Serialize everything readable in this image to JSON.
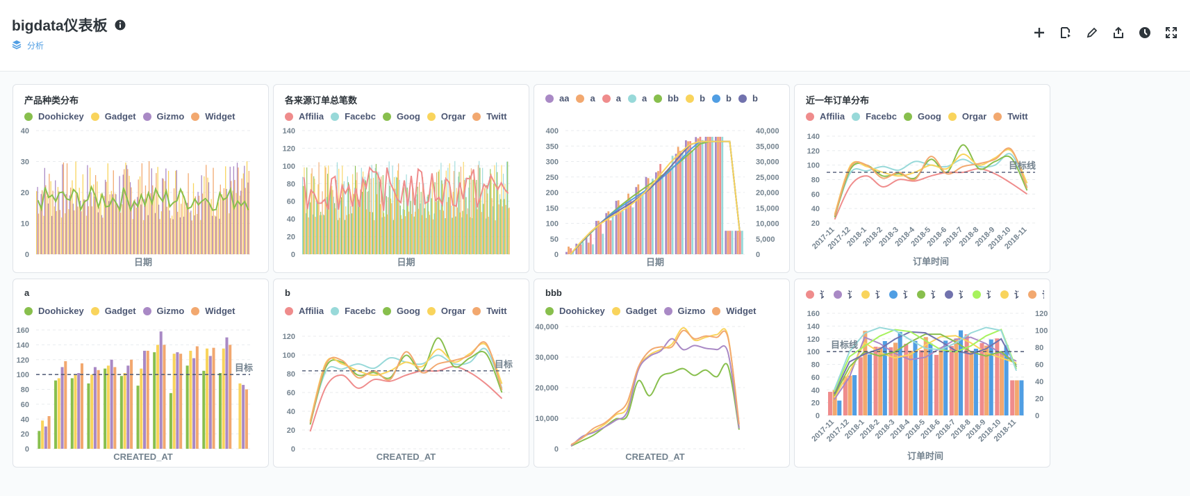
{
  "dashboard": {
    "title": "bigdata仪表板",
    "collection": "分析"
  },
  "actions": [
    "add-icon",
    "add-file-icon",
    "edit-icon",
    "share-icon",
    "history-icon",
    "fullscreen-icon"
  ],
  "colors": {
    "Doohickey": "#88bf4d",
    "Gadget": "#f9d45c",
    "Gizmo": "#a989c5",
    "Widget": "#f2a86f",
    "Affiliate": "#ef8c8c",
    "Facebook": "#98d9d9",
    "Google": "#88bf4d",
    "Organic": "#f9d45c",
    "Twitter": "#f2a86f",
    "blue": "#509ee3",
    "indigo": "#7172ad",
    "lime": "#a6e7f3"
  },
  "cards": [
    {
      "id": "c1",
      "title": "产品种类分布",
      "legend": [
        "Doohickey",
        "Gadget",
        "Gizmo",
        "Widget"
      ],
      "chart_data": {
        "type": "bar",
        "title": "产品种类分布",
        "xlabel": "日期",
        "ylim": [
          0,
          45
        ],
        "yticks": [
          "0",
          "10",
          "20",
          "30",
          "40"
        ],
        "series": [
          {
            "name": "Doohickey",
            "render": "line"
          },
          {
            "name": "Gadget"
          },
          {
            "name": "Gizmo"
          },
          {
            "name": "Widget"
          }
        ]
      }
    },
    {
      "id": "c2",
      "title": "各来源订单总笔数",
      "legend": [
        "Affiliate",
        "Facebook",
        "Google",
        "Organic",
        "Twitter"
      ],
      "legend_display": [
        "Affilia",
        "Facebc",
        "Goog",
        "Orgar",
        "Twitt"
      ],
      "chart_data": {
        "type": "bar",
        "title": "各来源订单总笔数",
        "xlabel": "日期",
        "ylim": [
          0,
          150
        ],
        "yticks": [
          "0",
          "20",
          "40",
          "60",
          "80",
          "100",
          "120",
          "140"
        ],
        "series": [
          {
            "name": "Affiliate",
            "render": "line"
          },
          {
            "name": "Facebook"
          },
          {
            "name": "Google"
          },
          {
            "name": "Organic"
          },
          {
            "name": "Twitter"
          }
        ]
      }
    },
    {
      "id": "c3",
      "title": "",
      "legend": [
        "aa",
        "a",
        "a",
        "a",
        "bb",
        "b",
        "b",
        "b"
      ],
      "legend_colors": [
        "#a989c5",
        "#f2a86f",
        "#ef8c8c",
        "#98d9d9",
        "#88bf4d",
        "#f9d45c",
        "#509ee3",
        "#7172ad"
      ],
      "chart_data": {
        "type": "bar",
        "xlabel": "日期",
        "ylim": [
          0,
          400
        ],
        "yticks": [
          "0",
          "50",
          "100",
          "150",
          "200",
          "250",
          "300",
          "350",
          "400"
        ],
        "y2ticks": [
          "0",
          "5,000",
          "10,000",
          "15,000",
          "20,000",
          "25,000",
          "30,000",
          "35,000",
          "40,000"
        ],
        "y2lim": [
          0,
          40000
        ],
        "series": [
          {
            "name": "aa"
          },
          {
            "name": "a"
          },
          {
            "name": "a"
          },
          {
            "name": "a"
          },
          {
            "name": "bb",
            "render": "line"
          },
          {
            "name": "b",
            "render": "line"
          },
          {
            "name": "b",
            "render": "line"
          },
          {
            "name": "b",
            "render": "line"
          }
        ]
      }
    },
    {
      "id": "c4",
      "title": "近一年订单分布",
      "legend": [
        "Affiliate",
        "Facebook",
        "Google",
        "Organic",
        "Twitter"
      ],
      "legend_display": [
        "Affilia",
        "Facebc",
        "Goog",
        "Orgar",
        "Twitt"
      ],
      "chart_data": {
        "type": "line",
        "title": "近一年订单分布",
        "xlabel": "订单时间",
        "categories": [
          "2017-11",
          "2017-12",
          "2018-1",
          "2018-2",
          "2018-3",
          "2018-4",
          "2018-5",
          "2018-6",
          "2018-7",
          "2018-8",
          "2018-9",
          "2018-10",
          "2018-11"
        ],
        "ylim": [
          20,
          140
        ],
        "yticks": [
          "20",
          "40",
          "60",
          "80",
          "100",
          "120",
          "140"
        ],
        "goal": {
          "label": "目标线",
          "value": 90
        },
        "series": [
          {
            "name": "Affiliate",
            "values": [
              25,
              72,
              85,
              70,
              80,
              78,
              85,
              90,
              90,
              95,
              88,
              75,
              60
            ]
          },
          {
            "name": "Facebook",
            "values": [
              30,
              90,
              92,
              98,
              93,
              105,
              100,
              98,
              108,
              98,
              100,
              115,
              70
            ]
          },
          {
            "name": "Google",
            "values": [
              28,
              95,
              100,
              85,
              88,
              82,
              108,
              90,
              128,
              95,
              105,
              110,
              65
            ]
          },
          {
            "name": "Organic",
            "values": [
              32,
              100,
              98,
              90,
              85,
              90,
              100,
              95,
              115,
              100,
              110,
              120,
              75
            ]
          },
          {
            "name": "Twitter",
            "values": [
              30,
              98,
              100,
              82,
              90,
              80,
              112,
              88,
              98,
              102,
              108,
              122,
              68
            ]
          }
        ]
      }
    },
    {
      "id": "c5",
      "title": "a",
      "legend": [
        "Doohickey",
        "Gadget",
        "Gizmo",
        "Widget"
      ],
      "chart_data": {
        "type": "bar",
        "title": "a",
        "xlabel": "CREATED_AT",
        "ylim": [
          0,
          160
        ],
        "yticks": [
          "0",
          "20",
          "40",
          "60",
          "80",
          "100",
          "120",
          "140",
          "160"
        ],
        "goal": {
          "label": "目标",
          "value": 100
        },
        "series": [
          {
            "name": "Doohickey",
            "values": [
              24,
              92,
              95,
              88,
              108,
              98,
              85,
              130,
              75,
              112,
              105,
              102,
              0
            ]
          },
          {
            "name": "Gadget",
            "values": [
              38,
              95,
              100,
              100,
              112,
              102,
              108,
              140,
              128,
              132,
              135,
              135,
              88
            ]
          },
          {
            "name": "Gizmo",
            "values": [
              30,
              110,
              102,
              110,
              120,
              112,
              132,
              158,
              130,
              122,
              125,
              150,
              86
            ]
          },
          {
            "name": "Widget",
            "values": [
              44,
              118,
              115,
              106,
              110,
              120,
              132,
              140,
              128,
              138,
              136,
              140,
              80
            ]
          }
        ]
      }
    },
    {
      "id": "c6",
      "title": "b",
      "legend": [
        "Affiliate",
        "Facebook",
        "Google",
        "Organic",
        "Twitter"
      ],
      "legend_display": [
        "Affilia",
        "Facebc",
        "Goog",
        "Orgar",
        "Twitt"
      ],
      "chart_data": {
        "type": "line",
        "title": "b",
        "xlabel": "CREATED_AT",
        "ylim": [
          0,
          130
        ],
        "yticks": [
          "0",
          "20",
          "40",
          "60",
          "80",
          "100",
          "120"
        ],
        "goal": {
          "label": "目标",
          "value": 90
        },
        "series": [
          {
            "name": "Affiliate",
            "values": [
              20,
              72,
              85,
              70,
              80,
              78,
              85,
              90,
              90,
              95,
              88,
              75,
              58
            ]
          },
          {
            "name": "Facebook",
            "values": [
              30,
              90,
              92,
              98,
              93,
              105,
              100,
              98,
              108,
              98,
              100,
              115,
              70
            ]
          },
          {
            "name": "Google",
            "values": [
              28,
              95,
              100,
              85,
              88,
              82,
              108,
              90,
              128,
              95,
              105,
              110,
              65
            ]
          },
          {
            "name": "Organic",
            "values": [
              32,
              100,
              98,
              90,
              85,
              90,
              100,
              95,
              115,
              100,
              110,
              120,
              75
            ]
          },
          {
            "name": "Twitter",
            "values": [
              30,
              98,
              102,
              82,
              90,
              80,
              112,
              88,
              98,
              102,
              108,
              122,
              68
            ]
          }
        ]
      }
    },
    {
      "id": "c7",
      "title": "bbb",
      "legend": [
        "Doohickey",
        "Gadget",
        "Gizmo",
        "Widget"
      ],
      "chart_data": {
        "type": "line",
        "title": "bbb",
        "xlabel": "CREATED_AT",
        "ylim": [
          0,
          45000
        ],
        "yticks": [
          "0",
          "10,000",
          "20,000",
          "30,000",
          "40,000"
        ],
        "series": [
          {
            "name": "Doohickey",
            "values": [
              1000,
              3000,
              5000,
              8000,
              11000,
              12000,
              25000,
              19500,
              26500,
              28000,
              29500,
              27000,
              29000,
              26500,
              30500,
              7000
            ]
          },
          {
            "name": "Gadget",
            "values": [
              1200,
              4000,
              6500,
              9000,
              12500,
              15000,
              29500,
              34500,
              36500,
              38500,
              44500,
              40000,
              41000,
              42000,
              41500,
              8000
            ]
          },
          {
            "name": "Gizmo",
            "values": [
              1000,
              4500,
              6000,
              8000,
              10500,
              13500,
              29000,
              34000,
              36000,
              40500,
              36500,
              38000,
              37000,
              36500,
              35500,
              7500
            ]
          },
          {
            "name": "Widget",
            "values": [
              1500,
              4000,
              7500,
              9500,
              13000,
              17000,
              30000,
              36000,
              37500,
              37500,
              43500,
              40500,
              41500,
              41000,
              41000,
              9000
            ]
          }
        ]
      }
    },
    {
      "id": "c8",
      "title": "",
      "legend": [
        "订",
        "订",
        "订",
        "订",
        "订",
        "订",
        "订",
        "订",
        "订",
        "订"
      ],
      "legend_colors": [
        "#ef8c8c",
        "#a989c5",
        "#f9d45c",
        "#509ee3",
        "#88bf4d",
        "#7172ad",
        "#a7f25d",
        "#f9d45c",
        "#f2a86f",
        "#98d9d9"
      ],
      "chart_data": {
        "type": "bar",
        "xlabel": "订单时间",
        "categories": [
          "2017-11",
          "2017-12",
          "2018-1",
          "2018-2",
          "2018-3",
          "2018-4",
          "2018-5",
          "2018-6",
          "2018-7",
          "2018-8",
          "2018-9",
          "2018-10",
          "2018-11"
        ],
        "ylim": [
          0,
          160
        ],
        "yticks": [
          "0",
          "20",
          "40",
          "60",
          "80",
          "100",
          "120",
          "140",
          "160"
        ],
        "y2ticks": [
          "0",
          "20",
          "40",
          "60",
          "80",
          "100",
          "120"
        ],
        "goal": {
          "label": "目标线",
          "value": 100
        }
      }
    }
  ]
}
